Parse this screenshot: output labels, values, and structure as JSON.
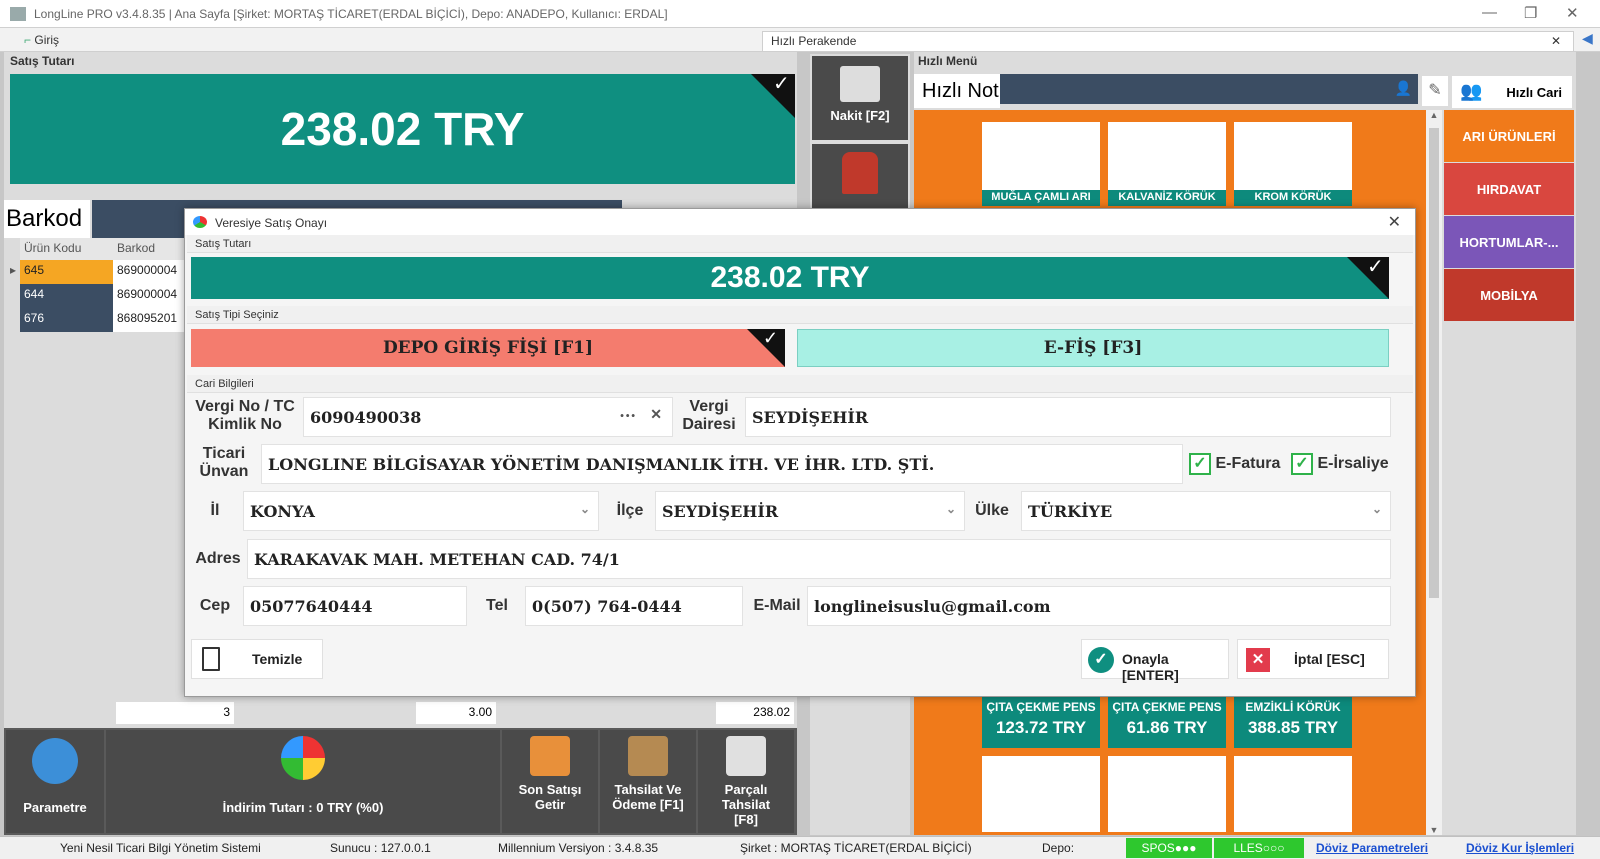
{
  "window": {
    "title": "LongLine PRO v3.4.8.35 | Ana Sayfa [Şirket: MORTAŞ TİCARET(ERDAL BİÇİCİ), Depo: ANADEPO, Kullanıcı: ERDAL]",
    "tabs": [
      {
        "label": "Giriş"
      },
      {
        "label": "Hızlı Perakende"
      }
    ]
  },
  "left": {
    "satis_tutan_label": "Satış Tutarı",
    "amount": "238.02 TRY",
    "barkod_label": "Barkod",
    "grid_headers": [
      "Ürün Kodu",
      "Barkod"
    ],
    "rows": [
      {
        "code": "645",
        "barcode": "869000004"
      },
      {
        "code": "644",
        "barcode": "869000004"
      },
      {
        "code": "676",
        "barcode": "868095201"
      }
    ],
    "totals": {
      "count": "3",
      "qty": "3.00",
      "sum": "238.02"
    }
  },
  "middle": {
    "nakit": "Nakit [F2]"
  },
  "right": {
    "menu_label": "Hızlı Menü",
    "hizli_not": "Hızlı Not",
    "hizli_cari": "Hızlı Cari",
    "categories": [
      {
        "label": "ARI ÜRÜNLERİ",
        "color": "#f07a1a"
      },
      {
        "label": "HIRDAVAT",
        "color": "#d9473f"
      },
      {
        "label": "HORTUMLAR-...",
        "color": "#7b56b8"
      },
      {
        "label": "MOBİLYA",
        "color": "#c0392b"
      }
    ],
    "top_products": [
      "MUĞLA ÇAMLI ARI",
      "KALVANİZ KÖRÜK",
      "KROM KÖRÜK"
    ],
    "bottom_products": [
      {
        "name": "ÇITA ÇEKME PENS",
        "price": "123.72 TRY"
      },
      {
        "name": "ÇITA ÇEKME PENS",
        "price": "61.86 TRY"
      },
      {
        "name": "EMZİKLİ KÖRÜK",
        "price": "388.85 TRY"
      }
    ]
  },
  "bottom": {
    "parametre": "Parametre",
    "indirim": "İndirim Tutarı : 0 TRY (%0)",
    "son_satis": "Son Satışı Getir",
    "tahsilat": "Tahsilat Ve Ödeme [F1]",
    "parcali": "Parçalı Tahsilat [F8]"
  },
  "status": {
    "system": "Yeni Nesil Ticari Bilgi Yönetim Sistemi",
    "sunucu": "Sunucu : 127.0.0.1",
    "version": "Millennium Versiyon : 3.4.8.35",
    "sirket": "Şirket : MORTAŞ TİCARET(ERDAL BİÇİCİ)",
    "depo": "Depo:",
    "spos": "SPOS●●●",
    "lles": "LLES○○○",
    "doviz_param": "Döviz Parametreleri",
    "doviz_kur": "Döviz Kur İşlemleri"
  },
  "dialog": {
    "title": "Veresiye Satış Onayı",
    "satis_tutan_label": "Satış Tutarı",
    "amount": "238.02 TRY",
    "satis_tipi_label": "Satış Tipi Seçiniz",
    "depo_btn": "DEPO GİRİŞ FİŞİ [F1]",
    "efis_btn": "E-FİŞ [F3]",
    "cari_label": "Cari Bilgileri",
    "vergi_no_label": "Vergi No / TC Kimlik No",
    "vergi_no": "6090490038",
    "vergi_dairesi_label": "Vergi Dairesi",
    "vergi_dairesi": "SEYDİŞEHİR",
    "ticari_unvan_label": "Ticari Ünvan",
    "ticari_unvan": "LONGLINE BİLGİSAYAR YÖNETİM DANIŞMANLIK İTH. VE İHR. LTD. ŞTİ.",
    "efatura": "E-Fatura",
    "eirsaliye": "E-İrsaliye",
    "il_label": "İl",
    "il": "KONYA",
    "ilce_label": "İlçe",
    "ilce": "SEYDİŞEHİR",
    "ulke_label": "Ülke",
    "ulke": "TÜRKİYE",
    "adres_label": "Adres",
    "adres": "KARAKAVAK MAH. METEHAN CAD. 74/1",
    "cep_label": "Cep",
    "cep": "05077640444",
    "tel_label": "Tel",
    "tel": "0(507) 764-0444",
    "email_label": "E-Mail",
    "email": "longlineisuslu@gmail.com",
    "temizle": "Temizle",
    "onayla": "Onayla [ENTER]",
    "iptal": "İptal [ESC]"
  }
}
